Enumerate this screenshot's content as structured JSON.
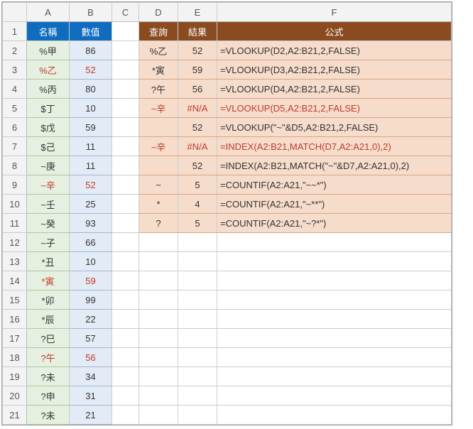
{
  "columns": [
    "A",
    "B",
    "C",
    "D",
    "E",
    "F"
  ],
  "rows": [
    "1",
    "2",
    "3",
    "4",
    "5",
    "6",
    "7",
    "8",
    "9",
    "10",
    "11",
    "12",
    "13",
    "14",
    "15",
    "16",
    "17",
    "18",
    "19",
    "20",
    "21"
  ],
  "left_header": {
    "name": "名稱",
    "value": "數值"
  },
  "right_header": {
    "query": "查詢",
    "result": "結果",
    "formula": "公式"
  },
  "left_data": [
    {
      "name": "%甲",
      "value": 86,
      "red": false
    },
    {
      "name": "%乙",
      "value": 52,
      "red": true
    },
    {
      "name": "%丙",
      "value": 80,
      "red": false
    },
    {
      "name": "$丁",
      "value": 10,
      "red": false
    },
    {
      "name": "$戊",
      "value": 59,
      "red": false
    },
    {
      "name": "$己",
      "value": 11,
      "red": false
    },
    {
      "name": "~庚",
      "value": 11,
      "red": false
    },
    {
      "name": "~辛",
      "value": 52,
      "red": true
    },
    {
      "name": "~壬",
      "value": 25,
      "red": false
    },
    {
      "name": "~癸",
      "value": 93,
      "red": false
    },
    {
      "name": "~子",
      "value": 66,
      "red": false
    },
    {
      "name": "*丑",
      "value": 10,
      "red": false
    },
    {
      "name": "*寅",
      "value": 59,
      "red": true
    },
    {
      "name": "*卯",
      "value": 99,
      "red": false
    },
    {
      "name": "*辰",
      "value": 22,
      "red": false
    },
    {
      "name": "?巳",
      "value": 57,
      "red": false
    },
    {
      "name": "?午",
      "value": 56,
      "red": true
    },
    {
      "name": "?未",
      "value": 34,
      "red": false
    },
    {
      "name": "?申",
      "value": 31,
      "red": false
    },
    {
      "name": "?未",
      "value": 21,
      "red": false
    }
  ],
  "right_data": [
    {
      "query": "%乙",
      "result": "52",
      "formula": "=VLOOKUP(D2,A2:B21,2,FALSE)",
      "red": false
    },
    {
      "query": "*寅",
      "result": "59",
      "formula": "=VLOOKUP(D3,A2:B21,2,FALSE)",
      "red": false
    },
    {
      "query": "?午",
      "result": "56",
      "formula": "=VLOOKUP(D4,A2:B21,2,FALSE)",
      "red": false
    },
    {
      "query": "~辛",
      "result": "#N/A",
      "formula": "=VLOOKUP(D5,A2:B21,2,FALSE)",
      "red": true
    },
    {
      "query": "",
      "result": "52",
      "formula": "=VLOOKUP(\"~\"&D5,A2:B21,2,FALSE)",
      "red": false
    },
    {
      "query": "~辛",
      "result": "#N/A",
      "formula": "=INDEX(A2:B21,MATCH(D7,A2:A21,0),2)",
      "red": true
    },
    {
      "query": "",
      "result": "52",
      "formula": "=INDEX(A2:B21,MATCH(\"~\"&D7,A2:A21,0),2)",
      "red": false
    },
    {
      "query": "~",
      "result": "5",
      "formula": "=COUNTIF(A2:A21,\"~~*\")",
      "red": false
    },
    {
      "query": "*",
      "result": "4",
      "formula": "=COUNTIF(A2:A21,\"~**\")",
      "red": false
    },
    {
      "query": "?",
      "result": "5",
      "formula": "=COUNTIF(A2:A21,\"~?*\")",
      "red": false
    }
  ],
  "chart_data": {
    "type": "table",
    "title": "VLOOKUP / INDEX / COUNTIF with wildcard characters",
    "left_table": {
      "columns": [
        "名稱",
        "數值"
      ],
      "rows": [
        [
          "%甲",
          86
        ],
        [
          "%乙",
          52
        ],
        [
          "%丙",
          80
        ],
        [
          "$丁",
          10
        ],
        [
          "$戊",
          59
        ],
        [
          "$己",
          11
        ],
        [
          "~庚",
          11
        ],
        [
          "~辛",
          52
        ],
        [
          "~壬",
          25
        ],
        [
          "~癸",
          93
        ],
        [
          "~子",
          66
        ],
        [
          "*丑",
          10
        ],
        [
          "*寅",
          59
        ],
        [
          "*卯",
          99
        ],
        [
          "*辰",
          22
        ],
        [
          "?巳",
          57
        ],
        [
          "?午",
          56
        ],
        [
          "?未",
          34
        ],
        [
          "?申",
          31
        ],
        [
          "?未",
          21
        ]
      ]
    },
    "right_table": {
      "columns": [
        "查詢",
        "結果",
        "公式"
      ],
      "rows": [
        [
          "%乙",
          "52",
          "=VLOOKUP(D2,A2:B21,2,FALSE)"
        ],
        [
          "*寅",
          "59",
          "=VLOOKUP(D3,A2:B21,2,FALSE)"
        ],
        [
          "?午",
          "56",
          "=VLOOKUP(D4,A2:B21,2,FALSE)"
        ],
        [
          "~辛",
          "#N/A",
          "=VLOOKUP(D5,A2:B21,2,FALSE)"
        ],
        [
          "",
          "52",
          "=VLOOKUP(\"~\"&D5,A2:B21,2,FALSE)"
        ],
        [
          "~辛",
          "#N/A",
          "=INDEX(A2:B21,MATCH(D7,A2:A21,0),2)"
        ],
        [
          "",
          "52",
          "=INDEX(A2:B21,MATCH(\"~\"&D7,A2:A21,0),2)"
        ],
        [
          "~",
          "5",
          "=COUNTIF(A2:A21,\"~~*\")"
        ],
        [
          "*",
          "4",
          "=COUNTIF(A2:A21,\"~**\")"
        ],
        [
          "?",
          "5",
          "=COUNTIF(A2:A21,\"~?*\")"
        ]
      ]
    }
  }
}
